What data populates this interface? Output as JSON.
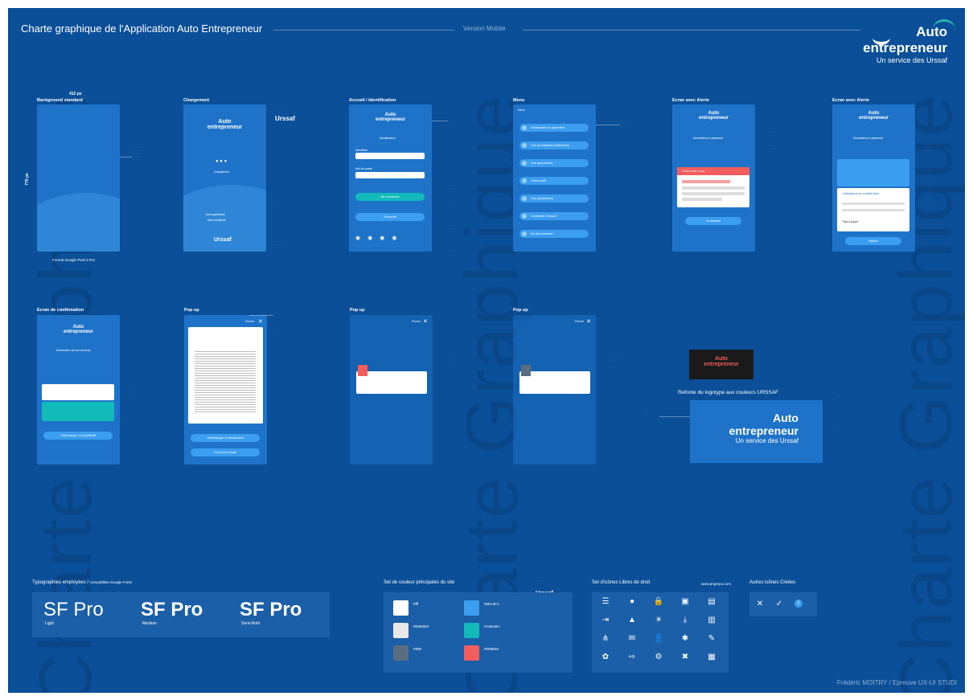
{
  "header": {
    "title": "Charte graphique de l'Application Auto Entrepreneur",
    "version": "Version Mobile"
  },
  "brand_logo": {
    "line1": "Auto",
    "line2": "entrepreneur",
    "line3": "Un service des Urssaf"
  },
  "watermark": "Charte Graphique",
  "screens_row1": [
    {
      "label": "Background standard"
    },
    {
      "label": "Chargement"
    },
    {
      "label": "Accueil / Identification"
    },
    {
      "label": "Menu"
    },
    {
      "label": "Ecran avec Alerte"
    },
    {
      "label": "Ecran avec Alerte"
    }
  ],
  "screens_row2": [
    {
      "label": "Ecran de confirmation"
    },
    {
      "label": "Pop up"
    },
    {
      "label": "Pop up"
    },
    {
      "label": "Pop up"
    }
  ],
  "dimension": {
    "width": "412 px",
    "height": "770 px",
    "format": "Format Google Pixel 4 Pro"
  },
  "loading": {
    "text": "Chargement",
    "slogan_a": "Une application",
    "slogan_b": "avec simplicité",
    "urssaf": "Urssaf"
  },
  "login": {
    "title": "Identification",
    "field1": "Identifiant",
    "field2": "Mot de passe",
    "submit": "Se connecter",
    "secondary": "S'inscrire"
  },
  "menu": {
    "close": "Menu",
    "items": [
      "Déclaration et paiement",
      "Vos prochaines échéances",
      "Vos documents",
      "Votre profil",
      "Vos paramètres",
      "Contacter l'Urssaf",
      "Se déconnecter"
    ]
  },
  "alert": {
    "section": "Déclaration et paiement",
    "banner": "Il vous reste 1 jour",
    "button": "Je déclare",
    "valid": "Valider",
    "contrib_title": "Cotisations et contribution",
    "total": "Total à payer"
  },
  "confirm": {
    "title": "Déclaration de vos revenus",
    "button": "Télécharger ce justificatif"
  },
  "popup": {
    "close": "Fermer",
    "download": "Télécharger la déclaration",
    "email": "Envoi par email"
  },
  "logotype_redesign": "Refonte du logotype aux couleurs URSSAF",
  "typography": {
    "title": "Typographies employées /",
    "subtitle": "compatibles Google Fonts",
    "samples": [
      {
        "name": "SF Pro",
        "weight": "Light"
      },
      {
        "name": "SF Pro",
        "weight": "Medium"
      },
      {
        "name": "SF Pro",
        "weight": "Semi-Bold"
      }
    ]
  },
  "colors": {
    "title": "Set de couleur principales du site",
    "swatches": [
      {
        "hex": "#fff",
        "color": "#ffffff"
      },
      {
        "hex": "#65A3FC",
        "color": "#3b9ef0"
      },
      {
        "hex": "#E9E8E8",
        "color": "#e9e8e8"
      },
      {
        "hex": "#12BABA",
        "color": "#12baba"
      },
      {
        "hex": "#999",
        "color": "#5a6e82"
      },
      {
        "hex": "#006B33",
        "color": "#f25d5d"
      }
    ]
  },
  "icons": {
    "title": "Set d'icônes",
    "subtitle": "Libres de droit",
    "source": "www.pngrepo.com",
    "glyphs": [
      "☰",
      "●",
      "🔒",
      "▣",
      "▤",
      "⇥",
      "▲",
      "☀",
      "⤓",
      "▥",
      "⋔",
      "✉",
      "👤",
      "✱",
      "✎",
      "✿",
      "⇨",
      "⚙",
      "✖",
      "▦"
    ]
  },
  "other_icons": {
    "title": "Autres icônes",
    "subtitle": "Créées",
    "glyphs": [
      "✕",
      "✓",
      "i"
    ]
  },
  "footer": "Frédéric MOITRY / Epreuve UX-UI STUDI"
}
